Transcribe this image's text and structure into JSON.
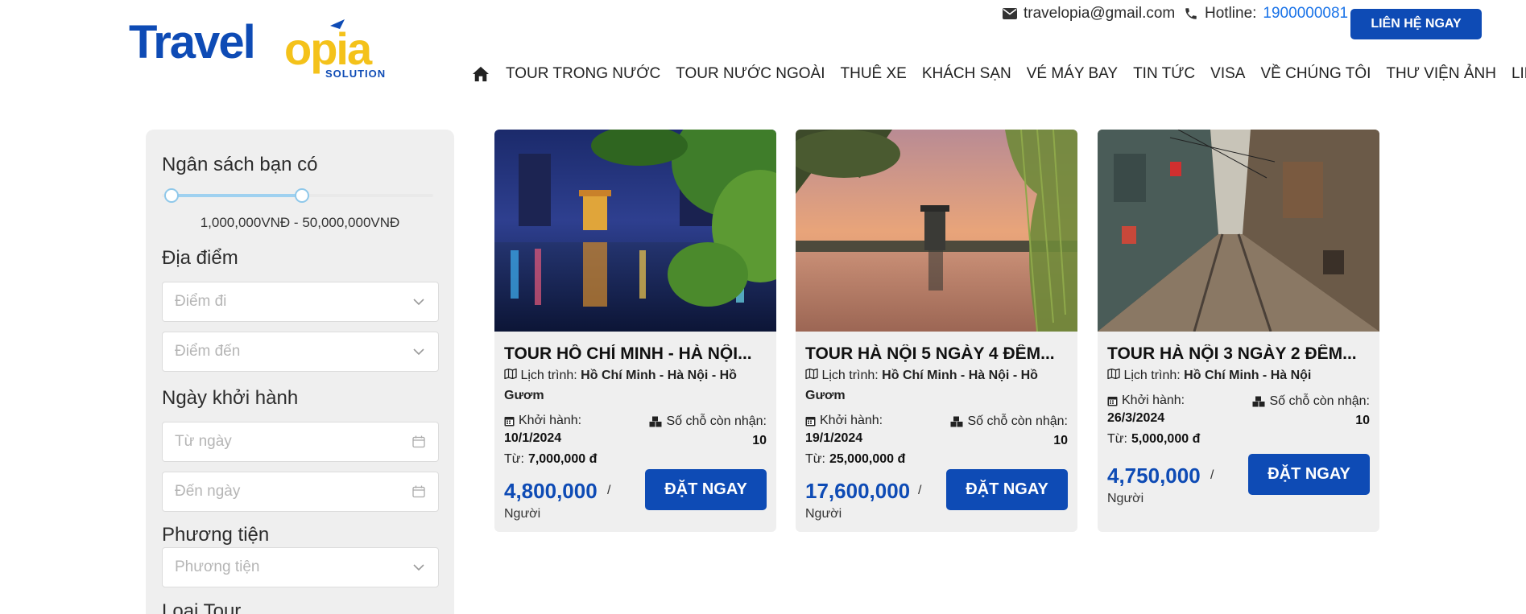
{
  "brand": {
    "name_part1": "Travel",
    "name_part2": "opia",
    "tagline": "SOLUTION",
    "primary_color": "#0e4bb5",
    "accent_color": "#f4c21a"
  },
  "header": {
    "email": "travelopia@gmail.com",
    "hotline_label": "Hotline:",
    "hotline_number": "1900000081",
    "cta_label": "LIÊN HỆ NGAY"
  },
  "nav": {
    "items": [
      "TOUR TRONG NƯỚC",
      "TOUR NƯỚC NGOÀI",
      "THUÊ XE",
      "KHÁCH SẠN",
      "VÉ MÁY BAY",
      "TIN TỨC",
      "VISA",
      "VỀ CHÚNG TÔI",
      "THƯ VIỆN ẢNH",
      "LIÊN HỆ"
    ]
  },
  "filters": {
    "budget_title": "Ngân sách bạn có",
    "budget_range": "1,000,000VNĐ - 50,000,000VNĐ",
    "location_title": "Địa điểm",
    "from_placeholder": "Điểm đi",
    "to_placeholder": "Điểm đến",
    "date_title": "Ngày khởi hành",
    "date_from_placeholder": "Từ ngày",
    "date_to_placeholder": "Đến ngày",
    "transport_title": "Phương tiện",
    "transport_placeholder": "Phương tiện",
    "tour_type_title": "Loại Tour"
  },
  "tours": [
    {
      "title": "TOUR HỒ CHÍ MINH - HÀ NỘI...",
      "route_label": "Lịch trình:",
      "route": "Hồ Chí Minh - Hà Nội - Hồ Gươm",
      "depart_label": "Khởi hành:",
      "depart_date": "10/1/2024",
      "seats_label": "Số chỗ còn nhận:",
      "seats": "10",
      "from_label": "Từ:",
      "original_price": "7,000,000 đ",
      "price": "4,800,000",
      "per_sep": "/",
      "per_unit": "Người",
      "book_label": "ĐẶT NGAY"
    },
    {
      "title": "TOUR HÀ NỘI 5 NGÀY 4 ĐÊM...",
      "route_label": "Lịch trình:",
      "route": "Hồ Chí Minh - Hà Nội - Hồ Gươm",
      "depart_label": "Khởi hành:",
      "depart_date": "19/1/2024",
      "seats_label": "Số chỗ còn nhận:",
      "seats": "10",
      "from_label": "Từ:",
      "original_price": "25,000,000 đ",
      "price": "17,600,000",
      "per_sep": "/",
      "per_unit": "Người",
      "book_label": "ĐẶT NGAY"
    },
    {
      "title": "TOUR HÀ NỘI 3 NGÀY 2 ĐÊM...",
      "route_label": "Lịch trình:",
      "route": "Hồ Chí Minh - Hà Nội",
      "depart_label": "Khởi hành:",
      "depart_date": "26/3/2024",
      "seats_label": "Số chỗ còn nhận:",
      "seats": "10",
      "from_label": "Từ:",
      "original_price": "5,000,000 đ",
      "price": "4,750,000",
      "per_sep": "/",
      "per_unit": "Người",
      "book_label": "ĐẶT NGAY"
    }
  ]
}
